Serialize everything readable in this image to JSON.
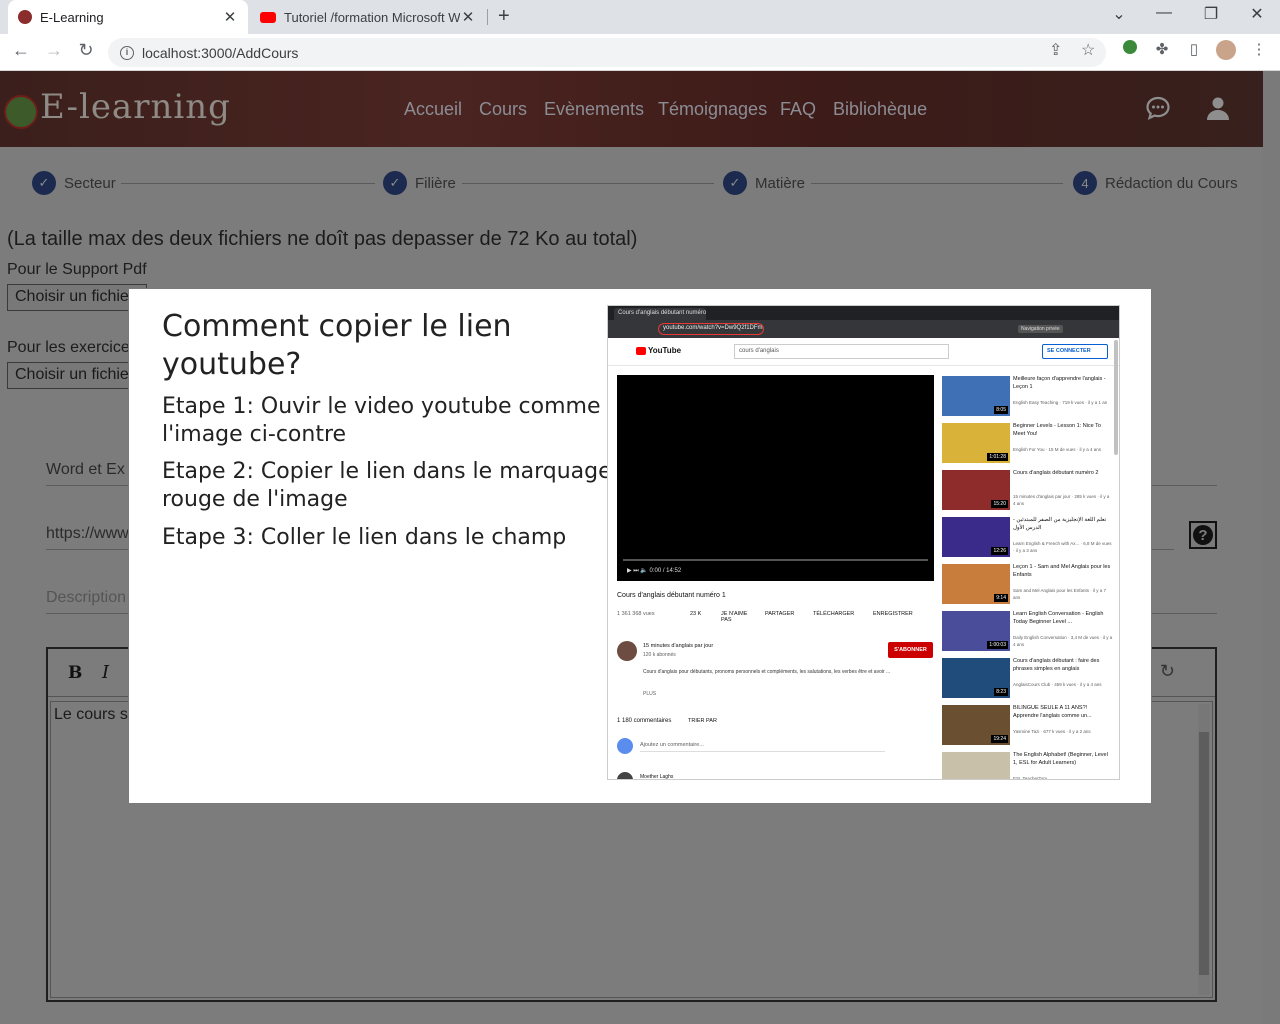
{
  "browser": {
    "tabs": [
      {
        "title": "E-Learning",
        "active": true
      },
      {
        "title": "Tutoriel /formation Microsoft Wo",
        "active": false
      }
    ],
    "url": "localhost:3000/AddCours"
  },
  "site": {
    "logo": "E-learning",
    "nav": [
      "Accueil",
      "Cours",
      "Evènements",
      "Témoignages",
      "FAQ",
      "Bibliohèque"
    ]
  },
  "stepper": [
    {
      "label": "Secteur",
      "state": "done"
    },
    {
      "label": "Filière",
      "state": "done"
    },
    {
      "label": "Matière",
      "state": "done"
    },
    {
      "label": "Rédaction du Cours",
      "number": "4",
      "state": "active"
    }
  ],
  "form": {
    "size_note": "(La taille max des deux fichiers ne doît pas depasser de 72 Ko au total)",
    "pdf_label": "Pour le Support Pdf",
    "file_button": "Choisir un fichier",
    "exercise_label": "Pour les exercices",
    "word_label": "Word et Ex",
    "url_value": "https://www",
    "description_placeholder": "Description",
    "editor_text": "Le cours s"
  },
  "modal": {
    "title": "Comment copier le lien youtube?",
    "steps": [
      "Etape 1: Ouvir le video youtube comme l'image ci-contre",
      "Etape 2: Copier le lien dans le marquage rouge de l'image",
      "Etape 3: Coller le lien dans le champ"
    ]
  },
  "screenshot": {
    "tab_title": "Cours d'anglais débutant numéro",
    "url": "youtube.com/watch?v=Dw9Q2f1DFm8",
    "private": "Navigation privée",
    "yt_logo": "YouTube",
    "search_value": "cours d'anglais",
    "signin": "SE CONNECTER",
    "time": "0:00 / 14:52",
    "video_title": "Cours d'anglais débutant numéro 1",
    "views": "1 361 368 vues",
    "likes": "23 K",
    "dislike": "JE N'AIME PAS",
    "share": "PARTAGER",
    "download": "TÉLÉCHARGER",
    "save": "ENREGISTRER",
    "channel": "15 minutes d'anglais par jour",
    "subscribers": "120 k abonnés",
    "subscribe": "S'ABONNER",
    "description": "Cours d'anglais pour débutants, pronoms personnels et compléments, les salutations, les verbes être et avoir ...",
    "more": "PLUS",
    "comments": "1 180 commentaires",
    "sort": "TRIER PAR",
    "add_comment": "Ajoutez un commentaire...",
    "commenter": "Moether Laghs",
    "recommendations": [
      {
        "title": "Meilleure façon d'apprendre l'anglais - Leçon 1",
        "meta": "English Easy Teaching · 719 k vues · il y a 1 an",
        "duration": "8:05",
        "color": "#3f6fb5"
      },
      {
        "title": "Beginner Levels - Lesson 1: Nice To Meet You!",
        "meta": "English For You · 15 M de vues · il y a 4 ans",
        "duration": "1:01:28",
        "color": "#d9b23a"
      },
      {
        "title": "Cours d'anglais débutant numéro 2",
        "meta": "15 minutes d'anglais par jour · 285 k vues · il y a 4 ans",
        "duration": "15:20",
        "color": "#8e2b2b"
      },
      {
        "title": "تعلم اللغة الإنجليزية من الصفر للمبتدئين - الدرس الأول",
        "meta": "Learn English & French with Ax... · 6,8 M de vues · il y a 3 ans",
        "duration": "12:26",
        "color": "#3a2a8a"
      },
      {
        "title": "Leçon 1 - Sam and Mel Anglais pour les Enfants",
        "meta": "Sam and Mel Anglais pour les Enfants · il y a 7 ans",
        "duration": "9:14",
        "color": "#c97d3c"
      },
      {
        "title": "Learn English Conversation - English Today Beginner Level ...",
        "meta": "Daily English Conversation · 3,4 M de vues · il y a 4 ans",
        "duration": "1:00:03",
        "color": "#4a4e9a"
      },
      {
        "title": "Cours d'anglais débutant : faire des phrases simples en anglais",
        "meta": "AnglaisCours Club · 459 k vues · il y a 4 ans",
        "duration": "8:23",
        "color": "#1f4c7a"
      },
      {
        "title": "BILINGUE SEULE A 11 ANS?! Apprendre l'anglais comme un...",
        "meta": "Yasmine Tazi · 677 k vues · il y a 2 ans",
        "duration": "19:24",
        "color": "#6a5030"
      },
      {
        "title": "The English Alphabet! (Beginner, Level 1, ESL for Adult Learners)",
        "meta": "ESL TeacherTom",
        "duration": "",
        "color": "#c8c0a8"
      }
    ]
  }
}
